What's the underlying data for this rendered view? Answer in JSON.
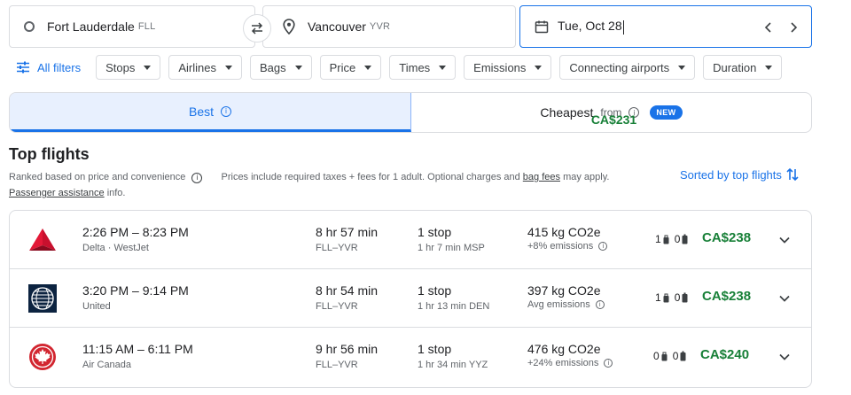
{
  "search": {
    "origin": {
      "city": "Fort Lauderdale",
      "code": "FLL"
    },
    "destination": {
      "city": "Vancouver",
      "code": "YVR"
    },
    "date": "Tue, Oct 28"
  },
  "filters": {
    "all_label": "All filters",
    "chips": [
      "Stops",
      "Airlines",
      "Bags",
      "Price",
      "Times",
      "Emissions",
      "Connecting airports",
      "Duration"
    ]
  },
  "tabs": {
    "best": "Best",
    "cheapest": "Cheapest",
    "cheapest_from": "from",
    "cheapest_price": "CA$231",
    "new_badge": "NEW"
  },
  "section": {
    "title": "Top flights",
    "subtitle_a": "Ranked based on price and convenience",
    "subtitle_b": "Prices include required taxes + fees for 1 adult. Optional charges and",
    "bag_fees": "bag fees",
    "subtitle_c": "may apply.",
    "passenger_link": "Passenger assistance",
    "subtitle_d": "info.",
    "sort_label": "Sorted by top flights"
  },
  "colors": {
    "accent": "#1a73e8",
    "price_green": "#188038",
    "delta_red": "#c8102e",
    "united_blue": "#0c2340",
    "aircanada_red": "#d22630"
  },
  "flights": [
    {
      "logo": "delta-logo",
      "times": "2:26 PM – 8:23 PM",
      "airline": "Delta · WestJet",
      "duration": "8 hr 57 min",
      "route": "FLL–YVR",
      "stops": "1 stop",
      "layover": "1 hr 7 min MSP",
      "co2": "415 kg CO2e",
      "emissions": "+8% emissions",
      "carry_on": "1",
      "checked": "0",
      "price": "CA$238"
    },
    {
      "logo": "united-logo",
      "times": "3:20 PM – 9:14 PM",
      "airline": "United",
      "duration": "8 hr 54 min",
      "route": "FLL–YVR",
      "stops": "1 stop",
      "layover": "1 hr 13 min DEN",
      "co2": "397 kg CO2e",
      "emissions": "Avg emissions",
      "carry_on": "1",
      "checked": "0",
      "price": "CA$238"
    },
    {
      "logo": "air-canada-logo",
      "times": "11:15 AM – 6:11 PM",
      "airline": "Air Canada",
      "duration": "9 hr 56 min",
      "route": "FLL–YVR",
      "stops": "1 stop",
      "layover": "1 hr 34 min YYZ",
      "co2": "476 kg CO2e",
      "emissions": "+24% emissions",
      "carry_on": "0",
      "checked": "0",
      "price": "CA$240"
    }
  ]
}
